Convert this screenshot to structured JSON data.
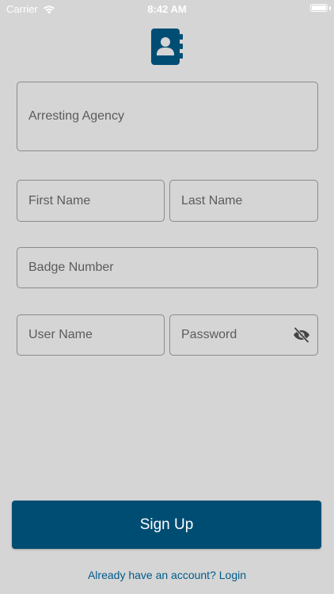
{
  "status_bar": {
    "carrier": "Carrier",
    "time": "8:42 AM",
    "wifi_icon": "wifi-icon",
    "battery_icon": "battery-icon"
  },
  "logo": {
    "icon": "contact-book-icon",
    "color": "#004d73"
  },
  "form": {
    "arresting_agency_placeholder": "Arresting Agency",
    "first_name_placeholder": "First Name",
    "last_name_placeholder": "Last Name",
    "badge_number_placeholder": "Badge Number",
    "user_name_placeholder": "User Name",
    "password_placeholder": "Password",
    "password_toggle_icon": "eye-off-icon"
  },
  "actions": {
    "signup_label": "Sign Up",
    "login_prompt": "Already have an account? Login"
  },
  "colors": {
    "background": "#d5d5d5",
    "primary": "#004d73",
    "link": "#005b8a",
    "field_border": "#8a8a8a",
    "placeholder_text": "#5c5c5c"
  }
}
